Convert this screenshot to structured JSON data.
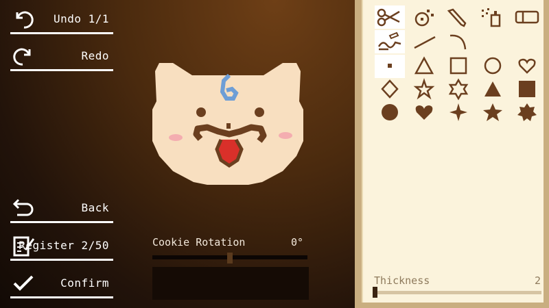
{
  "left_menu": {
    "undo_label": "Undo 1/1",
    "redo_label": "Redo",
    "back_label": "Back",
    "register_label": "Register 2/50",
    "confirm_label": "Confirm"
  },
  "rotation": {
    "label": "Cookie Rotation",
    "value": "0°",
    "slider_fraction": 0.5
  },
  "thickness": {
    "label": "Thickness",
    "value": "2",
    "slider_fraction": 0.0
  },
  "tools": [
    "scissors-icon",
    "sprinkle-icon",
    "pencil-icon",
    "spray-icon",
    "eraser-icon",
    "freehand-icon",
    "line-icon",
    "curve-icon",
    "dot-icon",
    "triangle-outline-icon",
    "square-outline-icon",
    "circle-outline-icon",
    "heart-outline-icon",
    "diamond-outline-icon",
    "star-outline-icon",
    "star-of-david-outline-icon",
    "triangle-filled-icon",
    "square-filled-icon",
    "circle-filled-icon",
    "heart-filled-icon",
    "diamond-star-filled-icon",
    "star-filled-icon",
    "flower-filled-icon"
  ],
  "colors": {
    "cookie": "#f8dfc0",
    "brown": "#6b3f1f",
    "blue": "#6e9ed6",
    "tongue": "#d9302a",
    "blush": "#f4adb0",
    "panel": "#fbf3dc"
  }
}
